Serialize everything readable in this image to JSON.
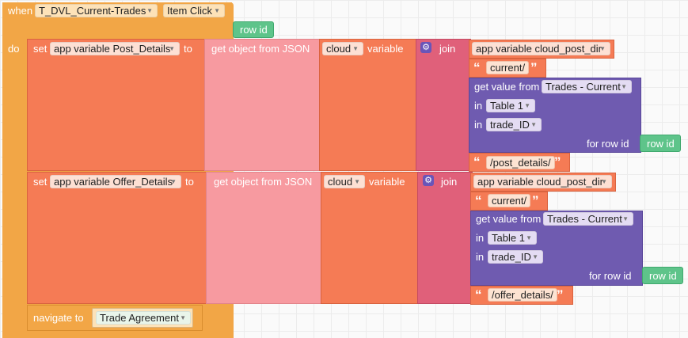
{
  "event": {
    "when_label": "when",
    "component": "T_DVL_Current-Trades",
    "event_name": "Item Click",
    "param": "row id",
    "do_label": "do"
  },
  "blocks": [
    {
      "set_label": "set",
      "variable": "app variable Post_Details",
      "to_label": "to",
      "get_json_label": "get object from JSON",
      "source": "cloud",
      "source_suffix": "variable",
      "join_label": "join",
      "dir_var": "app variable cloud_post_dir",
      "text1": "current/",
      "getvalue_label": "get value from",
      "table_source": "Trades - Current",
      "in_label": "in",
      "table": "Table 1",
      "column": "trade_ID",
      "for_row_label": "for row id",
      "row_id": "row id",
      "text2": "/post_details/"
    },
    {
      "set_label": "set",
      "variable": "app variable Offer_Details",
      "to_label": "to",
      "get_json_label": "get object from JSON",
      "source": "cloud",
      "source_suffix": "variable",
      "join_label": "join",
      "dir_var": "app variable cloud_post_dir",
      "text1": "current/",
      "getvalue_label": "get value from",
      "table_source": "Trades - Current",
      "in_label": "in",
      "table": "Table 1",
      "column": "trade_ID",
      "for_row_label": "for row id",
      "row_id": "row id",
      "text2": "/offer_details/"
    }
  ],
  "navigate": {
    "label": "navigate to",
    "target": "Trade Agreement"
  },
  "icons": {
    "quote_open": "“",
    "quote_close": "”",
    "gear": "⚙",
    "dropdown": "▼"
  },
  "colors": {
    "event": "#f2a646",
    "set_block": "#f57b55",
    "json_block": "#f79aa0",
    "cloud_block": "#f57b55",
    "join_block": "#e0607a",
    "dir_block": "#f57b55",
    "text_block": "#f57b55",
    "getvalue_block": "#6f5bb0",
    "rowid_block": "#5ec48a",
    "navigate_block": "#f2a646"
  }
}
